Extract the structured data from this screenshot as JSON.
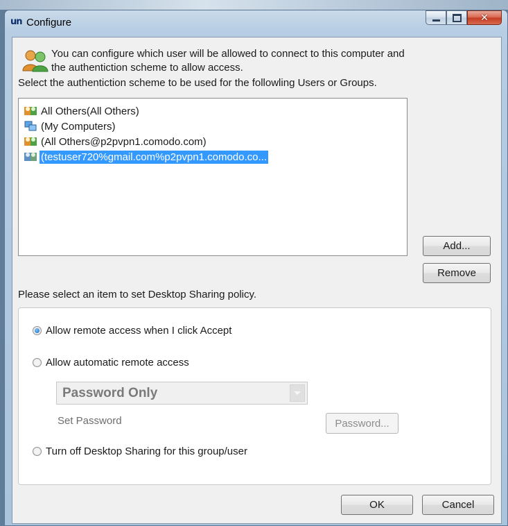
{
  "window": {
    "title": "Configure",
    "app_icon_text": "un"
  },
  "intro": {
    "text_line1": "You can configure which user will be allowed to connect to this computer and",
    "text_line2": "the authentiction  scheme  to allow access."
  },
  "select_label": "Select the authentiction scheme to be used for the followling Users or Groups.",
  "user_list": {
    "items": [
      {
        "label": "All Others(All Others)",
        "icon": "users-group-icon",
        "selected": false
      },
      {
        "label": "(My Computers)",
        "icon": "computers-icon",
        "selected": false
      },
      {
        "label": "(All Others@p2pvpn1.comodo.com)",
        "icon": "users-group-icon",
        "selected": false
      },
      {
        "label": "(testuser720%gmail.com%p2pvpn1.comodo.co...",
        "icon": "users-group-icon",
        "selected": true
      }
    ]
  },
  "buttons": {
    "add": "Add...",
    "remove": "Remove",
    "password": "Password...",
    "ok": "OK",
    "cancel": "Cancel"
  },
  "policy_label": "Please select an item to set Desktop Sharing policy.",
  "policy": {
    "option_accept": "Allow remote access when I click Accept",
    "option_automatic": "Allow automatic remote access",
    "auth_scheme_value": "Password Only",
    "set_password_label": "Set Password",
    "option_off": "Turn off Desktop Sharing for this group/user",
    "selected_option": "option_accept"
  },
  "colors": {
    "selection": "#3399ff",
    "close_button": "#c94a32",
    "titlebar": "#b6cde3"
  }
}
